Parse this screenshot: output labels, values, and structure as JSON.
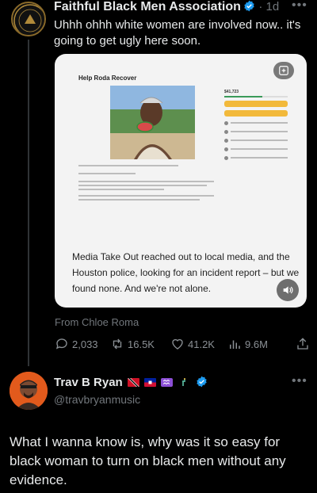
{
  "post1": {
    "author_name": "Faithful Black Men Association",
    "time": "1d",
    "text": "Uhhh ohhh white women are involved now.. it's going to get ugly here soon.",
    "media": {
      "fundraiser_title": "Help Roda Recover",
      "fundraiser_amount": "$41,723",
      "overlay_text": "Media Take Out reached out to local media, and the Houston police, looking for an incident report – but we found none. And we're not alone."
    },
    "from": "From Chloe Roma",
    "stats": {
      "replies": "2,033",
      "reposts": "16.5K",
      "likes": "41.2K",
      "views": "9.6M"
    }
  },
  "post2": {
    "author_name": "Trav B Ryan",
    "handle": "@travbryanmusic",
    "text": "What I wanna know is, why was it so easy for black woman to turn on black men without any evidence."
  },
  "colors": {
    "background": "#000000",
    "text": "#e7e9ea",
    "muted": "#71767b",
    "verified": "#1d9bf0"
  }
}
